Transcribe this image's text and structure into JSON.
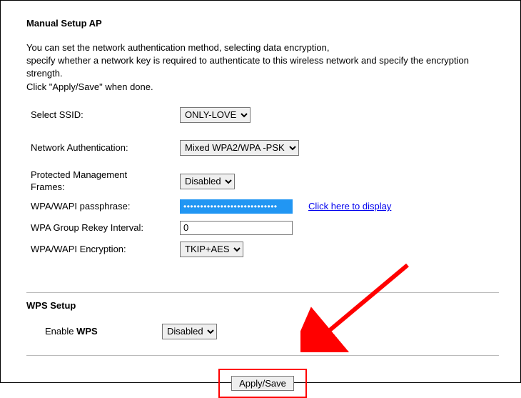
{
  "title": "Manual Setup AP",
  "intro_line1": "You can set the network authentication method, selecting data encryption,",
  "intro_line2": "specify whether a network key is required to authenticate to this wireless network and specify the encryption strength.",
  "intro_line3": "Click \"Apply/Save\" when done.",
  "labels": {
    "ssid": "Select SSID:",
    "auth": "Network Authentication:",
    "pmf_line1": "Protected Management",
    "pmf_line2": "Frames:",
    "pass": "WPA/WAPI passphrase:",
    "rekey": "WPA Group Rekey Interval:",
    "encryption": "WPA/WAPI Encryption:"
  },
  "values": {
    "ssid": "ONLY-LOVE",
    "auth": "Mixed WPA2/WPA -PSK",
    "pmf": "Disabled",
    "pass": "••••••••••••••••••••••••••••",
    "rekey": "0",
    "encryption": "TKIP+AES"
  },
  "link_display": "Click here to display",
  "wps": {
    "section_title": "WPS Setup",
    "label_prefix": "Enable ",
    "label_bold": "WPS",
    "value": "Disabled"
  },
  "button_label": "Apply/Save",
  "colors": {
    "highlight": "#ff0000",
    "link": "#0000ee",
    "pass_bg": "#2196f3"
  }
}
